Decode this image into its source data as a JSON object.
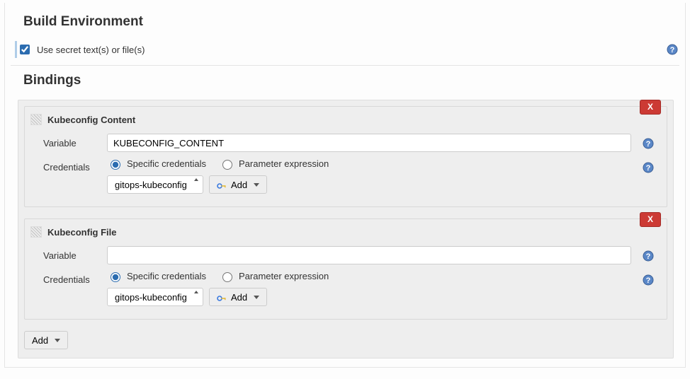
{
  "sections": {
    "build_env": "Build Environment",
    "bindings": "Bindings"
  },
  "build_env": {
    "use_secret_label": "Use secret text(s) or file(s)",
    "use_secret_checked": true
  },
  "bindings": [
    {
      "title": "Kubeconfig Content",
      "variable_label": "Variable",
      "variable_value": "KUBECONFIG_CONTENT",
      "credentials_label": "Credentials",
      "radio_specific": "Specific credentials",
      "radio_param": "Parameter expression",
      "selected_credential": "gitops-kubeconfig",
      "add_cred_label": "Add",
      "delete_label": "X"
    },
    {
      "title": "Kubeconfig File",
      "variable_label": "Variable",
      "variable_value": "",
      "credentials_label": "Credentials",
      "radio_specific": "Specific credentials",
      "radio_param": "Parameter expression",
      "selected_credential": "gitops-kubeconfig",
      "add_cred_label": "Add",
      "delete_label": "X"
    }
  ],
  "add_binding_label": "Add"
}
